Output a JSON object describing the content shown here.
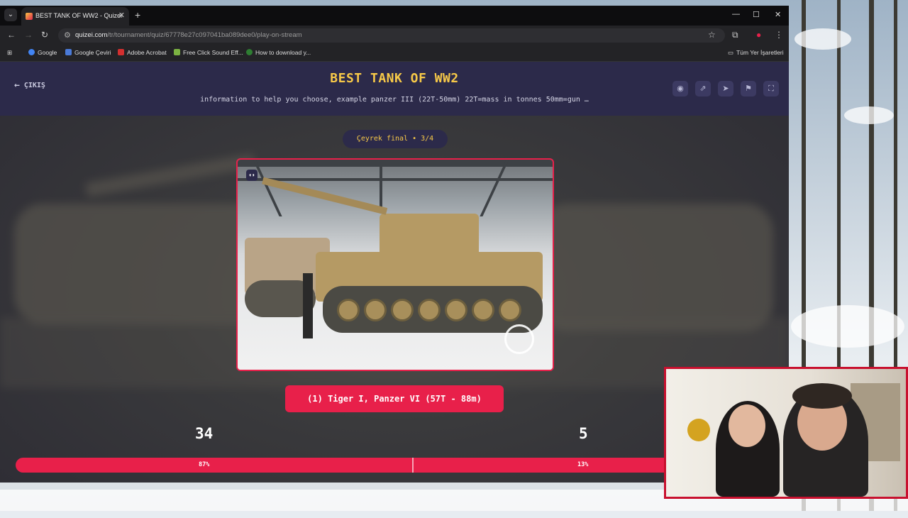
{
  "browser": {
    "tab_title": "BEST TANK OF WW2 - Quizei",
    "url_host": "quizei.com",
    "url_path": "/tr/tournament/quiz/67778e27c097041ba089dee0/play-on-stream",
    "bookmarks": [
      "Google",
      "Google Çeviri",
      "Adobe Acrobat",
      "Free Click Sound Eff...",
      "How to download y..."
    ],
    "all_bookmarks": "Tüm Yer İşaretleri"
  },
  "quiz": {
    "exit_label": "ÇIKIŞ",
    "title": "BEST TANK OF WW2",
    "subtitle": "information to help you choose, example panzer III (22T-50mm) 22T=mass in tonnes 50mm=gun …",
    "round": "Çeyrek final • 3/4",
    "choice_name": "(1) Tiger I, Panzer VI (57T - 88m)",
    "votes_left": "34",
    "votes_right": "5",
    "percent_left": "87%",
    "percent_right": "13%",
    "percent_left_value": 87
  },
  "colors": {
    "accent": "#e8204a",
    "title": "#f7c948",
    "header_bg": "#2c2a4a"
  },
  "icons": [
    "eye-icon",
    "share-icon",
    "send-icon",
    "flag-icon",
    "fullscreen-icon"
  ]
}
